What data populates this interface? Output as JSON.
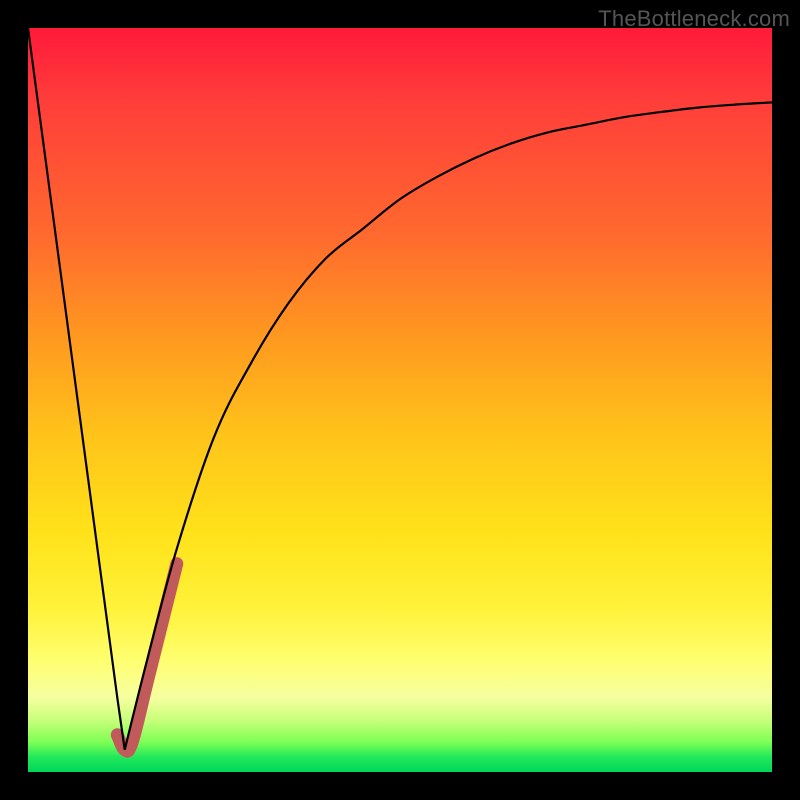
{
  "watermark": "TheBottleneck.com",
  "colors": {
    "frame": "#000000",
    "curve": "#000000",
    "hook": "#c15a5a",
    "gradient_top": "#ff1a3a",
    "gradient_bottom": "#00d65a"
  },
  "chart_data": {
    "type": "line",
    "title": "",
    "xlabel": "",
    "ylabel": "",
    "xlim": [
      0,
      100
    ],
    "ylim": [
      0,
      100
    ],
    "grid": false,
    "legend": false,
    "description": "Bottleneck-style curve: steep linear drop from (0,100) to a minimum near x≈13, y≈3, followed by a rising saturating curve toward (100,~90). A short salmon hook overlays the minimum region.",
    "series": [
      {
        "name": "main-curve",
        "color": "#000000",
        "x": [
          0,
          4,
          8,
          12,
          13,
          16,
          20,
          25,
          30,
          35,
          40,
          45,
          50,
          55,
          60,
          65,
          70,
          75,
          80,
          85,
          90,
          95,
          100
        ],
        "values": [
          100,
          70,
          40,
          10,
          3,
          15,
          30,
          45,
          55,
          63,
          69,
          73,
          77,
          80,
          82.5,
          84.5,
          86,
          87,
          88,
          88.7,
          89.3,
          89.7,
          90
        ]
      },
      {
        "name": "hook-overlay",
        "color": "#c15a5a",
        "x": [
          12,
          13,
          14,
          16,
          18,
          20
        ],
        "values": [
          5,
          3,
          4,
          12,
          20,
          28
        ]
      }
    ]
  }
}
